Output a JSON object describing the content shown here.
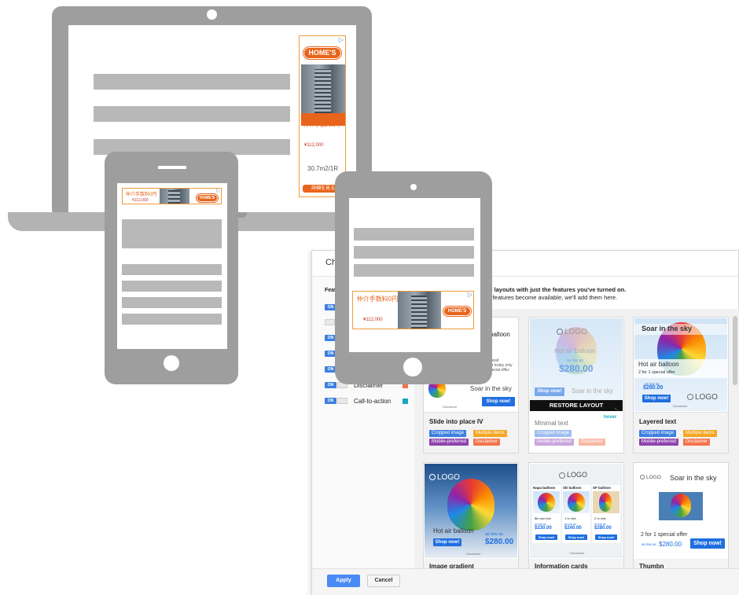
{
  "colors": {
    "device_gray": "#9e9e9e",
    "ad_orange": "#e8641b",
    "accent_blue": "#1f6fe0",
    "apply_blue": "#4a8af4"
  },
  "laptop_ad": {
    "logo": "HOME'S",
    "jp_text": "仲介手数料0円",
    "price": "¥112,000",
    "size": "30.7m2/1R",
    "button": "詳細を見る"
  },
  "phone_ad": {
    "text": "仲介手数料0円",
    "price": "¥112,000",
    "logo": "HOME'S"
  },
  "tablet_ad": {
    "text": "仲介手数料0円",
    "price": "¥112,000",
    "logo": "HOME'S"
  },
  "dialog": {
    "title": "Ch",
    "description_line1": "d layouts with just the features you've turned on.",
    "description_line2": "r features become available, we'll add them here.",
    "features_header": "Feat",
    "features": [
      {
        "toggle": "ON",
        "label": "",
        "color": ""
      },
      {
        "toggle": "",
        "label": "",
        "color": ""
      },
      {
        "toggle": "ON",
        "label": "",
        "color": ""
      },
      {
        "toggle": "ON",
        "label": "",
        "color": ""
      },
      {
        "toggle": "ON",
        "label": "",
        "color": ""
      },
      {
        "toggle": "ON",
        "label": "Disclaimer",
        "color": "#f4734b"
      },
      {
        "toggle": "ON",
        "label": "Call-to-action",
        "color": "#17a8c4"
      }
    ],
    "apply": "Apply",
    "cancel": "Cancel"
  },
  "cards": {
    "card1": {
      "top_text": "balloon",
      "small_text": "t visit\nor today only\npecial offer.",
      "headline": "Soar in the sky",
      "cta": "Shop now!",
      "disclaimer": "Disclaimer",
      "name": "Slide into place IV",
      "tags": [
        {
          "label": "Cropped image",
          "color": "#3d80e0"
        },
        {
          "label": "Multiple items",
          "color": "#f5a623"
        },
        {
          "label": "Mobile-preferred",
          "color": "#8e44ad"
        },
        {
          "label": "Disclaimer",
          "color": "#f4734b"
        }
      ]
    },
    "card2": {
      "logo": "LOGO",
      "headline": "Hot air balloon",
      "as_low_as": "as low as",
      "price": "$280.00",
      "cta": "Shop now!",
      "tagline": "Soar in the sky",
      "restore": "RESTORE LAYOUT",
      "hover": "hover",
      "name": "Minimal text",
      "tags": [
        {
          "label": "Cropped image",
          "color": "#9dbdf0"
        },
        {
          "label": "Mobile-preferred",
          "color": "#c9a6dc"
        },
        {
          "label": "Disclaimer",
          "color": "#f8b8a2"
        }
      ]
    },
    "card3": {
      "headline": "Soar in the sky",
      "subhead": "Hot air balloon",
      "offer": "2 for 1 special offer",
      "as_low_as": "as low as",
      "price": "$280.00",
      "cta": "Shop now!",
      "logo": "LOGO",
      "disclaimer": "Disclaimer",
      "name": "Layered text",
      "tags": [
        {
          "label": "Cropped image",
          "color": "#3d80e0"
        },
        {
          "label": "Multiple items",
          "color": "#f5a623"
        },
        {
          "label": "Mobile-preferred",
          "color": "#8e44ad"
        },
        {
          "label": "Disclaimer",
          "color": "#f4734b"
        }
      ]
    },
    "card4": {
      "logo": "LOGO",
      "headline": "Hot air balloon",
      "as_low_as": "as low as",
      "price": "$280.00",
      "cta": "Shop now!",
      "disclaimer": "Disclaimer",
      "name": "Image gradient"
    },
    "card5": {
      "logo": "LOGO",
      "items": [
        {
          "title": "Napa balloon",
          "ride": "$6 mini ride",
          "as_low_as": "as low as",
          "price": "$230.00",
          "cta": "Shop now!"
        },
        {
          "title": "SD balloon",
          "ride": "1 hr ride",
          "as_low_as": "as low as",
          "price": "$240.00",
          "cta": "Shop now!"
        },
        {
          "title": "SF balloon",
          "ride": "2 hr ride",
          "as_low_as": "as low as",
          "price": "$280.00",
          "cta": "Shop now!"
        }
      ],
      "disclaimer": "Disclaimer",
      "name": "Information cards"
    },
    "card6": {
      "logo": "LOGO",
      "headline": "Soar in the sky",
      "offer": "2 for 1 special offer",
      "as_low_as": "as low as",
      "price": "$280.00",
      "cta": "Shop now!",
      "name": "Thumbn"
    }
  }
}
